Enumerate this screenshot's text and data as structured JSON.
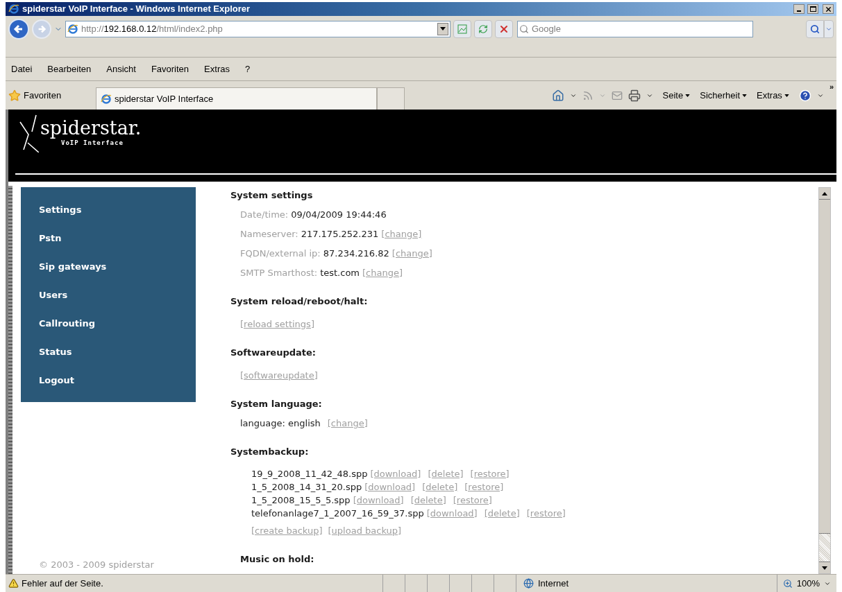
{
  "window": {
    "title": "spiderstar VoIP Interface - Windows Internet Explorer"
  },
  "address_bar": {
    "url_prefix": "http://",
    "url_host": "192.168.0.12",
    "url_path": "/html/index2.php"
  },
  "search": {
    "placeholder": "Google"
  },
  "menu": [
    "Datei",
    "Bearbeiten",
    "Ansicht",
    "Favoriten",
    "Extras",
    "?"
  ],
  "favorites_bar": {
    "label": "Favoriten",
    "tab_title": "spiderstar VoIP Interface"
  },
  "command_bar": [
    "Seite",
    "Sicherheit",
    "Extras"
  ],
  "toolbar_overflow": "»",
  "header": {
    "logo": "spiderstar.",
    "tagline": "VoIP Interface"
  },
  "sidebar": {
    "items": [
      "Settings",
      "Pstn",
      "Sip gateways",
      "Users",
      "Callrouting",
      "Status",
      "Logout"
    ],
    "copyright": "© 2003 - 2009 spiderstar"
  },
  "sections": [
    {
      "heading": "System settings",
      "fields": [
        {
          "label": "Date/time:",
          "value": "09/04/2009 19:44:46"
        },
        {
          "label": "Nameserver:",
          "value": "217.175.252.231",
          "link": "[change]"
        },
        {
          "label": "FQDN/external ip:",
          "value": "87.234.216.82",
          "link": "[change]"
        },
        {
          "label": "SMTP Smarthost:",
          "value": "test.com",
          "link": "[change]"
        }
      ]
    },
    {
      "heading": "System reload/reboot/halt:",
      "links": [
        "[reload settings]"
      ]
    },
    {
      "heading": "Softwareupdate:",
      "links": [
        "[softwareupdate]"
      ]
    },
    {
      "heading": "System language:",
      "fields": [
        {
          "value": "language: english",
          "link": "[change]"
        }
      ]
    },
    {
      "heading": "Systembackup:",
      "backups": [
        {
          "file": "19_9_2008_11_42_48.spp",
          "links": [
            "[download]",
            "[delete]",
            "[restore]"
          ]
        },
        {
          "file": "1_5_2008_14_31_20.spp",
          "links": [
            "[download]",
            "[delete]",
            "[restore]"
          ]
        },
        {
          "file": "1_5_2008_15_5_5.spp",
          "links": [
            "[download]",
            "[delete]",
            "[restore]"
          ]
        },
        {
          "file": "telefonanlage7_1_2007_16_59_37.spp",
          "links": [
            "[download]",
            "[delete]",
            "[restore]"
          ]
        }
      ],
      "links": [
        "[create backup]",
        "[upload backup]"
      ]
    },
    {
      "heading": "Music on hold:"
    }
  ],
  "status_bar": {
    "message": "Fehler auf der Seite.",
    "zone": "Internet",
    "zoom": "100%"
  }
}
